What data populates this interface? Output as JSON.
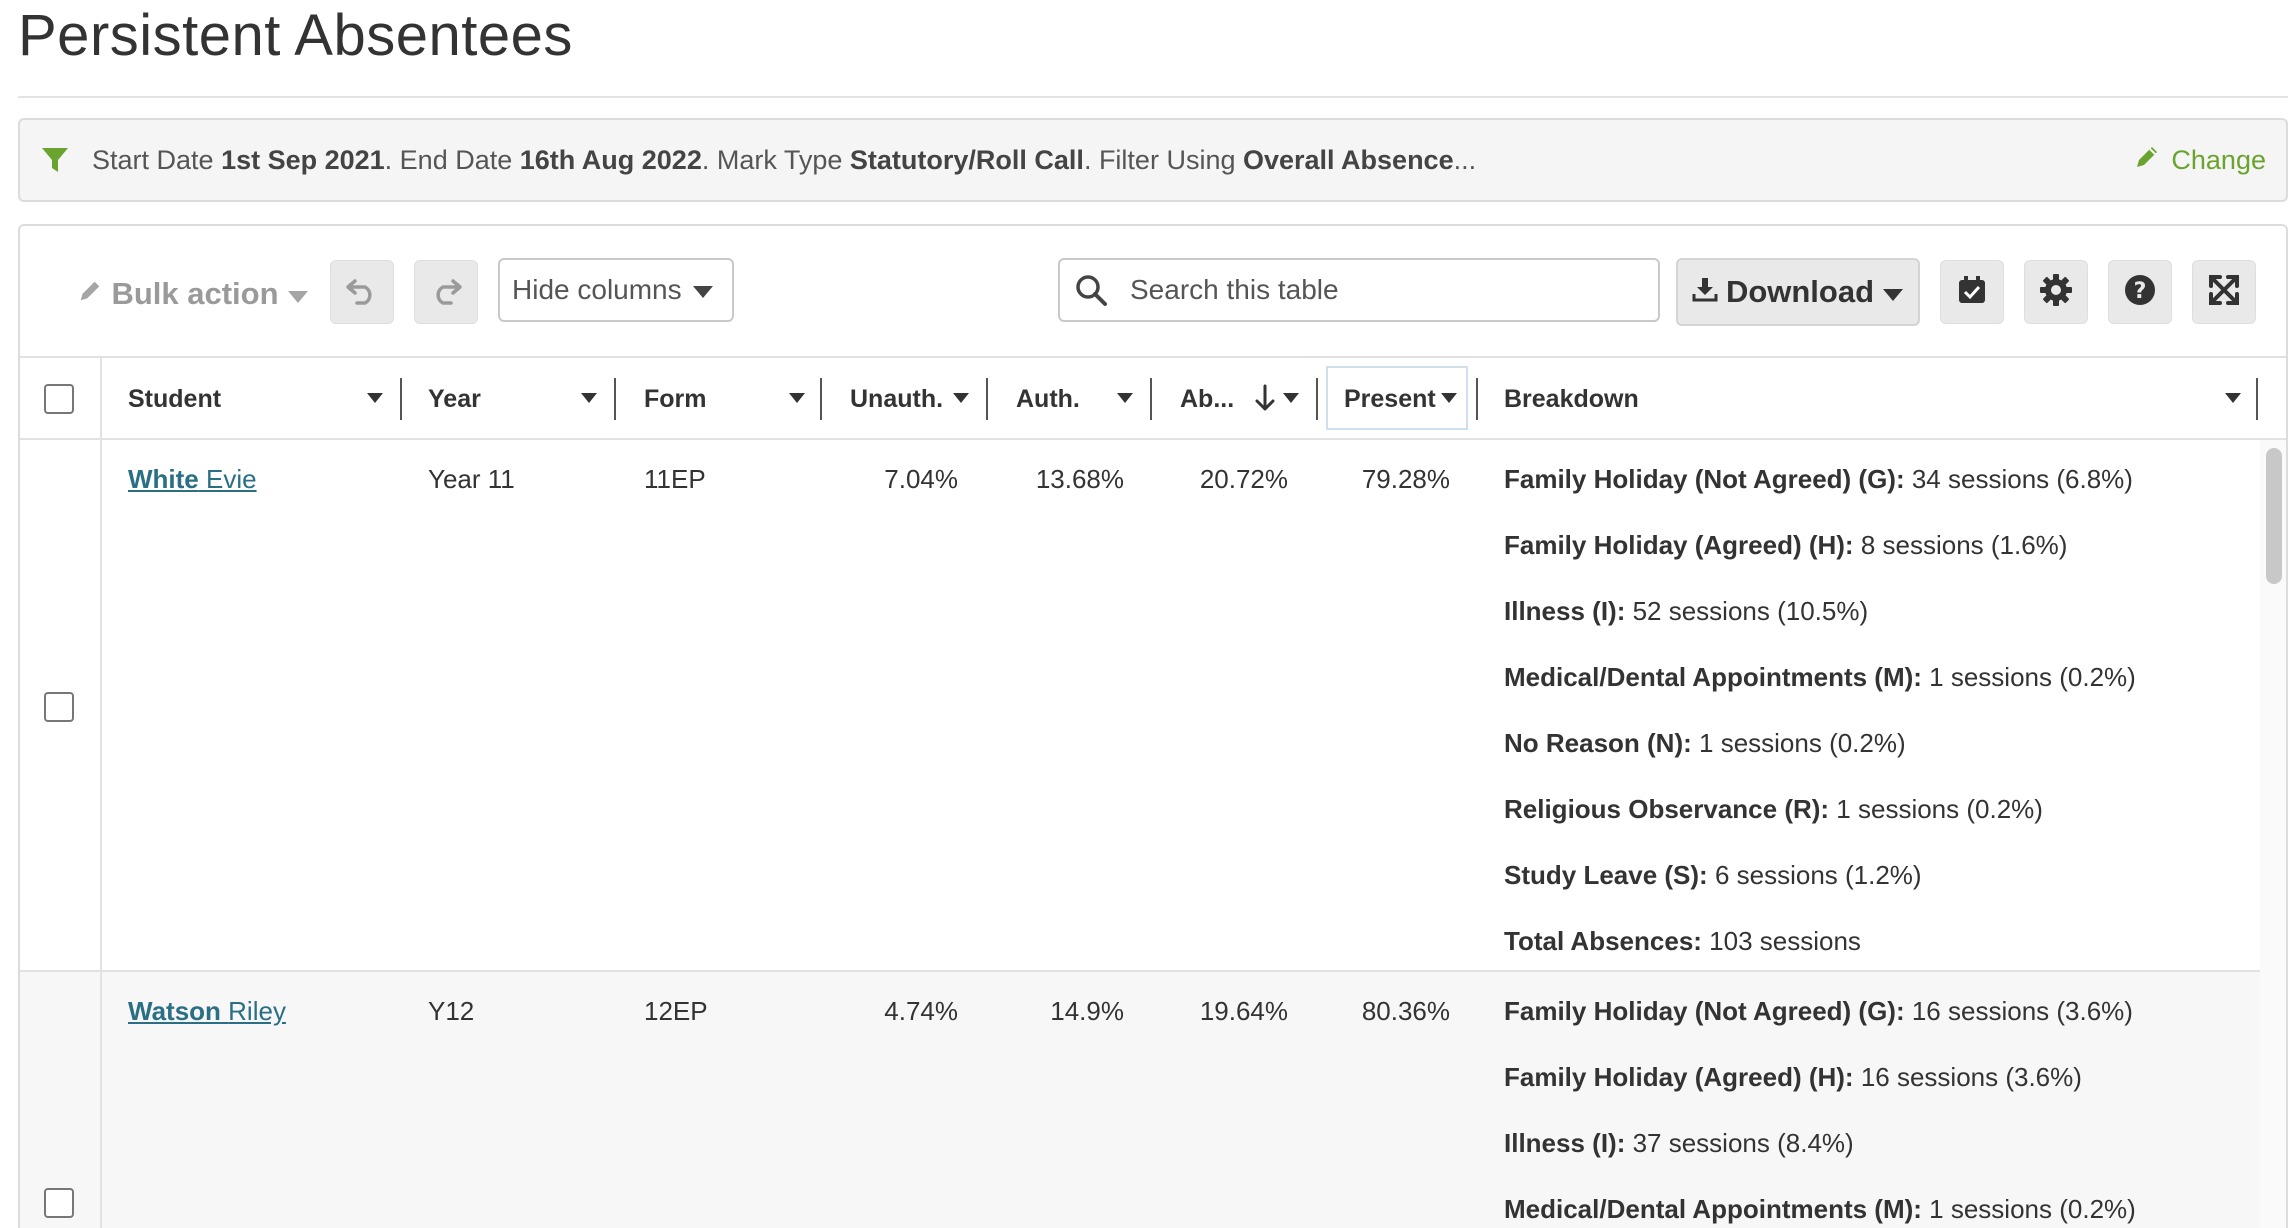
{
  "page": {
    "title": "Persistent Absentees"
  },
  "filter": {
    "parts": [
      {
        "text": "Start Date ",
        "bold": false
      },
      {
        "text": "1st Sep 2021",
        "bold": true
      },
      {
        "text": ". End Date ",
        "bold": false
      },
      {
        "text": "16th Aug 2022",
        "bold": true
      },
      {
        "text": ". Mark Type ",
        "bold": false
      },
      {
        "text": "Statutory/Roll Call",
        "bold": true
      },
      {
        "text": ". Filter Using ",
        "bold": false
      },
      {
        "text": "Overall Absence",
        "bold": true
      },
      {
        "text": "...",
        "bold": false
      }
    ],
    "change_label": "Change",
    "accent_color": "#6aa32d"
  },
  "toolbar": {
    "bulk_action_label": "Bulk action",
    "hide_columns_label": "Hide columns",
    "search_placeholder": "Search this table",
    "download_label": "Download",
    "icons": [
      "undo-icon",
      "redo-icon",
      "calendar-check-icon",
      "gear-icon",
      "help-icon",
      "fullscreen-icon"
    ]
  },
  "table": {
    "columns": {
      "student": "Student",
      "year": "Year",
      "form": "Form",
      "unauth": "Unauth.",
      "auth": "Auth.",
      "absent": "Ab...",
      "present": "Present",
      "breakdown": "Breakdown"
    },
    "sort": {
      "column": "absent",
      "direction": "descending"
    },
    "rows": [
      {
        "surname": "White",
        "forename": "Evie",
        "year": "Year 11",
        "form": "11EP",
        "unauth": "7.04%",
        "auth": "13.68%",
        "absent": "20.72%",
        "present": "79.28%",
        "breakdown": [
          {
            "label": "Family Holiday (Not Agreed) (G):",
            "value": "34 sessions (6.8%)"
          },
          {
            "label": "Family Holiday (Agreed) (H):",
            "value": "8 sessions (1.6%)"
          },
          {
            "label": "Illness (I):",
            "value": "52 sessions (10.5%)"
          },
          {
            "label": "Medical/Dental Appointments (M):",
            "value": "1 sessions (0.2%)"
          },
          {
            "label": "No Reason (N):",
            "value": "1 sessions (0.2%)"
          },
          {
            "label": "Religious Observance (R):",
            "value": "1 sessions (0.2%)"
          },
          {
            "label": "Study Leave (S):",
            "value": "6 sessions (1.2%)"
          },
          {
            "label": "Total Absences:",
            "value": "103 sessions"
          }
        ]
      },
      {
        "surname": "Watson",
        "forename": "Riley",
        "year": "Y12",
        "form": "12EP",
        "unauth": "4.74%",
        "auth": "14.9%",
        "absent": "19.64%",
        "present": "80.36%",
        "breakdown": [
          {
            "label": "Family Holiday (Not Agreed) (G):",
            "value": "16 sessions (3.6%)"
          },
          {
            "label": "Family Holiday (Agreed) (H):",
            "value": "16 sessions (3.6%)"
          },
          {
            "label": "Illness (I):",
            "value": "37 sessions (8.4%)"
          },
          {
            "label": "Medical/Dental Appointments (M):",
            "value": "1 sessions (0.2%)"
          }
        ]
      }
    ]
  }
}
